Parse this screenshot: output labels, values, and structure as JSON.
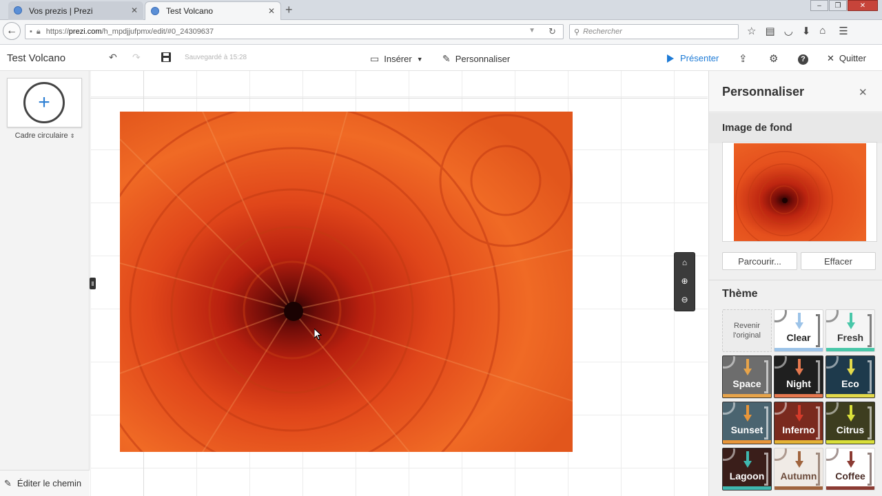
{
  "browser": {
    "tabs": [
      {
        "label": "Vos prezis | Prezi"
      },
      {
        "label": "Test Volcano"
      }
    ],
    "url": {
      "prefix": "https://",
      "host": "prezi.com",
      "path": "/h_mpdjjufpmx/edit/#0_24309637"
    },
    "search_placeholder": "Rechercher"
  },
  "toolbar": {
    "title": "Test Volcano",
    "saved": "Sauvegardé à 15:28",
    "insert": "Insérer",
    "customize": "Personnaliser",
    "present": "Présenter",
    "quit": "Quitter"
  },
  "leftpanel": {
    "frame_type": "Cadre circulaire",
    "edit_path": "Éditer le chemin"
  },
  "rightpanel": {
    "title": "Personnaliser",
    "background_title": "Image de fond",
    "browse": "Parcourir...",
    "clear": "Effacer",
    "theme_title": "Thème",
    "revert": "Revenir\nl'original",
    "themes": [
      {
        "name": "Clear",
        "bg": "#ffffff",
        "fg": "#222222",
        "accent": "#9cc3e8",
        "stripe": "#9cc3e8"
      },
      {
        "name": "Fresh",
        "bg": "#f5f5f5",
        "fg": "#333333",
        "accent": "#49c7a9",
        "stripe": "#49c7a9"
      },
      {
        "name": "Space",
        "bg": "#6d6d6d",
        "fg": "#ffffff",
        "accent": "#e8a44a",
        "stripe": "#e8a44a"
      },
      {
        "name": "Night",
        "bg": "#1f1f1f",
        "fg": "#ffffff",
        "accent": "#e6784f",
        "stripe": "#e6784f"
      },
      {
        "name": "Eco",
        "bg": "#1e3a4c",
        "fg": "#ffffff",
        "accent": "#e3d94a",
        "stripe": "#e3d94a"
      },
      {
        "name": "Sunset",
        "bg": "#4a6470",
        "fg": "#ffffff",
        "accent": "#e8963a",
        "stripe": "#e8963a"
      },
      {
        "name": "Inferno",
        "bg": "#7a2a1e",
        "fg": "#ffffff",
        "accent": "#d43b2a",
        "stripe": "#e4b335"
      },
      {
        "name": "Citrus",
        "bg": "#3d3d1f",
        "fg": "#ffffff",
        "accent": "#d9df3a",
        "stripe": "#d9df3a"
      },
      {
        "name": "Lagoon",
        "bg": "#3a1e1a",
        "fg": "#ffffff",
        "accent": "#3fb8b0",
        "stripe": "#3fb8b0"
      },
      {
        "name": "Autumn",
        "bg": "#f0ebe6",
        "fg": "#6b4a3a",
        "accent": "#a0643e",
        "stripe": "#a0643e"
      },
      {
        "name": "Coffee",
        "bg": "#ffffff",
        "fg": "#4a2c26",
        "accent": "#8b3b33",
        "stripe": "#8b3b33"
      }
    ]
  },
  "icons": {
    "back": "back-arrow-icon",
    "lock": "lock-icon",
    "undo": "undo-icon",
    "redo": "redo-icon",
    "save": "save-icon",
    "share": "share-icon",
    "settings": "gear-icon",
    "help": "help-icon",
    "home": "home-icon",
    "zoom_in": "zoom-in-icon",
    "zoom_out": "zoom-out-icon"
  },
  "colors": {
    "accent": "#1e7bd6"
  }
}
